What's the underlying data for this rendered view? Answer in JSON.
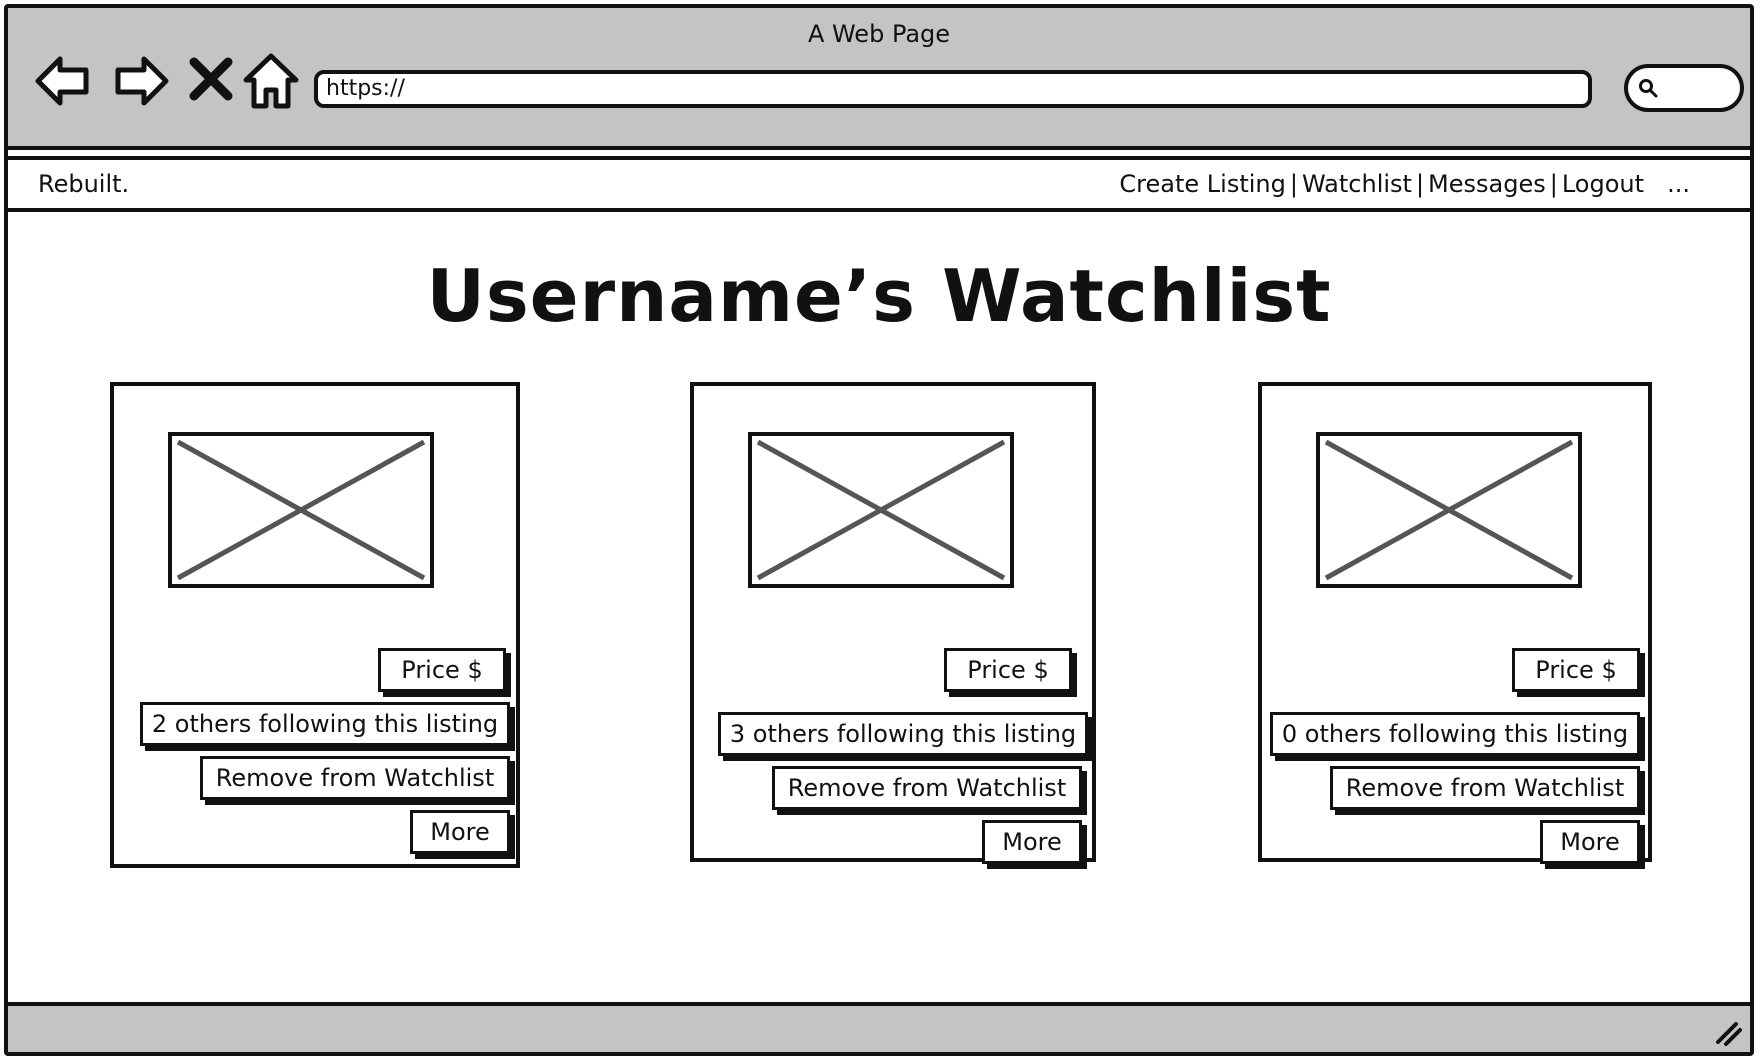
{
  "browser": {
    "title": "A Web Page",
    "url": "https://",
    "nav_icons": [
      "back-arrow-icon",
      "forward-arrow-icon",
      "close-icon",
      "home-icon"
    ],
    "search_icon": "search-icon"
  },
  "topbar": {
    "brand": "Rebuilt.",
    "links": [
      "Create Listing",
      "Watchlist",
      "Messages",
      "Logout"
    ],
    "separator": "|",
    "overflow": "..."
  },
  "page": {
    "title": "Username’s Watchlist"
  },
  "cards": [
    {
      "price_label": "Price $",
      "followers_label": "2 others following this listing",
      "remove_label": "Remove from Watchlist",
      "more_label": "More"
    },
    {
      "price_label": "Price $",
      "followers_label": "3 others following this listing",
      "remove_label": "Remove from Watchlist",
      "more_label": "More"
    },
    {
      "price_label": "Price $",
      "followers_label": "0 others following this listing",
      "remove_label": "Remove from Watchlist",
      "more_label": "More"
    }
  ],
  "colors": {
    "chrome_gray": "#c4c4c4",
    "stroke": "#111111",
    "placeholder_x": "#555555"
  }
}
